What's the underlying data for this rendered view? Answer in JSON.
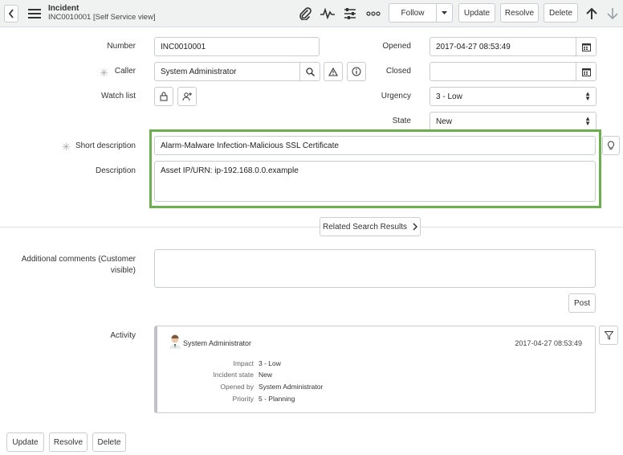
{
  "header": {
    "title": "Incident",
    "subtitle": "INC0010001 [Self Service view]",
    "follow_label": "Follow",
    "update_label": "Update",
    "resolve_label": "Resolve",
    "delete_label": "Delete"
  },
  "form": {
    "number": {
      "label": "Number",
      "value": "INC0010001"
    },
    "caller": {
      "label": "Caller",
      "value": "System Administrator"
    },
    "watch_list": {
      "label": "Watch list"
    },
    "opened": {
      "label": "Opened",
      "value": "2017-04-27 08:53:49"
    },
    "closed": {
      "label": "Closed",
      "value": ""
    },
    "urgency": {
      "label": "Urgency",
      "value": "3 - Low"
    },
    "state": {
      "label": "State",
      "value": "New"
    },
    "short_description": {
      "label": "Short description",
      "value": "Alarm-Malware Infection-Malicious SSL Certificate"
    },
    "description": {
      "label": "Description",
      "value": "Asset IP/URN: ip-192.168.0.0.example"
    },
    "related_search_label": "Related Search Results",
    "additional_comments": {
      "label_line1": "Additional comments (Customer",
      "label_line2": "visible)",
      "value": ""
    },
    "post_label": "Post",
    "activity_label": "Activity"
  },
  "activity": {
    "user": "System Administrator",
    "timestamp": "2017-04-27 08:53:49",
    "rows": [
      {
        "key": "Impact",
        "value": "3 - Low"
      },
      {
        "key": "Incident state",
        "value": "New"
      },
      {
        "key": "Opened by",
        "value": "System Administrator"
      },
      {
        "key": "Priority",
        "value": "5 - Planning"
      }
    ]
  },
  "footer": {
    "update_label": "Update",
    "resolve_label": "Resolve",
    "delete_label": "Delete"
  },
  "colors": {
    "highlight": "#6ab04c",
    "header_bg": "#f0f1f1"
  }
}
